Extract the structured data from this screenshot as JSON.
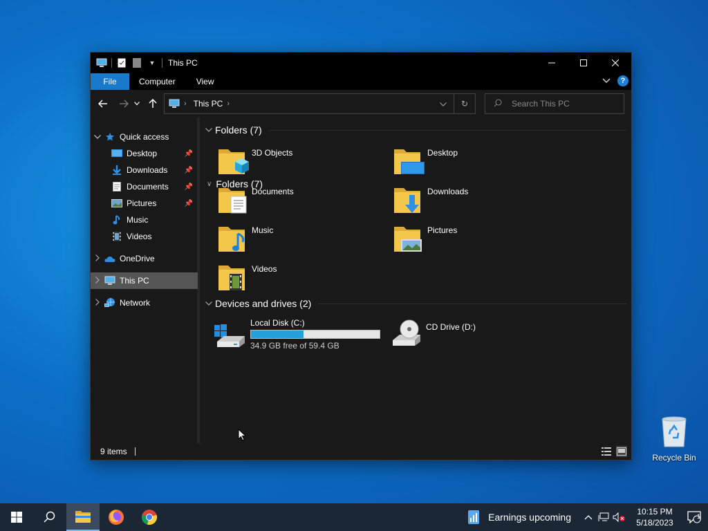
{
  "window": {
    "title": "This PC",
    "ribbon_tabs": [
      "File",
      "Computer",
      "View"
    ],
    "address": {
      "crumb": "This PC"
    },
    "search_placeholder": "Search This PC",
    "status_count": "9 items"
  },
  "nav": {
    "quick_access": "Quick access",
    "quick_items": [
      {
        "label": "Desktop",
        "icon": "desktop-folder-icon",
        "pinned": true
      },
      {
        "label": "Downloads",
        "icon": "downloads-icon",
        "pinned": true
      },
      {
        "label": "Documents",
        "icon": "documents-icon",
        "pinned": true
      },
      {
        "label": "Pictures",
        "icon": "pictures-icon",
        "pinned": true
      },
      {
        "label": "Music",
        "icon": "music-icon",
        "pinned": false
      },
      {
        "label": "Videos",
        "icon": "videos-icon",
        "pinned": false
      }
    ],
    "onedrive": "OneDrive",
    "this_pc": "This PC",
    "network": "Network"
  },
  "content": {
    "folders_header": "Folders (7)",
    "folders": [
      {
        "name": "3D Objects",
        "icon": "3d-objects-folder-icon"
      },
      {
        "name": "Desktop",
        "icon": "desktop-folder-icon"
      },
      {
        "name": "Documents",
        "icon": "documents-folder-icon"
      },
      {
        "name": "Downloads",
        "icon": "downloads-folder-icon"
      },
      {
        "name": "Music",
        "icon": "music-folder-icon"
      },
      {
        "name": "Pictures",
        "icon": "pictures-folder-icon"
      },
      {
        "name": "Videos",
        "icon": "videos-folder-icon"
      }
    ],
    "devices_header": "Devices and drives (2)",
    "drives": [
      {
        "name": "Local Disk (C:)",
        "free_text": "34.9 GB free of 59.4 GB",
        "used_fraction": 0.41
      },
      {
        "name": "CD Drive (D:)"
      }
    ]
  },
  "desktop": {
    "recycle_bin": "Recycle Bin"
  },
  "taskbar": {
    "news": "Earnings upcoming",
    "time": "10:15 PM",
    "date": "5/18/2023",
    "notification_count": "1"
  },
  "colors": {
    "accent": "#1979ca",
    "bar_fill": "#26a0da",
    "folder": "#f3c84a"
  }
}
